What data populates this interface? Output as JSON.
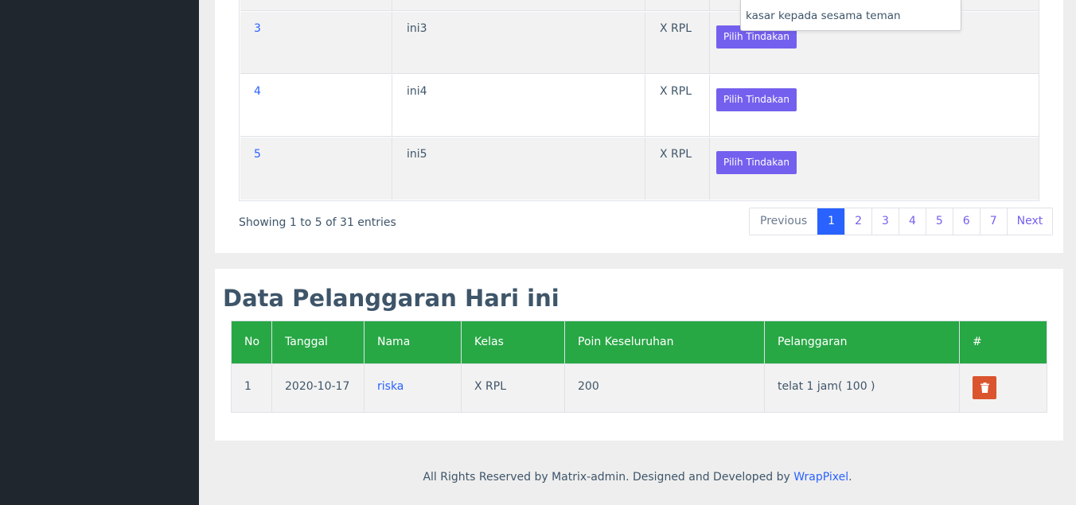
{
  "table_top": {
    "rows": [
      {
        "no": "3",
        "nama": "ini3",
        "kelas": "X RPL",
        "action": "Pilih Tindakan"
      },
      {
        "no": "4",
        "nama": "ini4",
        "kelas": "X RPL",
        "action": "Pilih Tindakan"
      },
      {
        "no": "5",
        "nama": "ini5",
        "kelas": "X RPL",
        "action": "Pilih Tindakan"
      }
    ],
    "dropdown_text": "kasar kepada sesama teman",
    "info": "Showing 1 to 5 of 31 entries",
    "pagination": {
      "previous": "Previous",
      "pages": [
        "1",
        "2",
        "3",
        "4",
        "5",
        "6",
        "7"
      ],
      "next": "Next",
      "active_page": "1"
    }
  },
  "pelanggaran": {
    "title": "Data Pelanggaran Hari ini",
    "headers": [
      "No",
      "Tanggal",
      "Nama",
      "Kelas",
      "Poin Keseluruhan",
      "Pelanggaran",
      "#"
    ],
    "rows": [
      {
        "no": "1",
        "tanggal": "2020-10-17",
        "nama": "riska",
        "kelas": "X RPL",
        "poin": "200",
        "pelanggaran": "telat 1 jam( 100 )"
      }
    ],
    "header_color": "#28a745",
    "delete_color": "#da542e"
  },
  "footer": {
    "text": "All Rights Reserved by Matrix-admin. Designed and Developed by ",
    "link": "WrapPixel",
    "end": "."
  },
  "colors": {
    "sidebar": "#1f262d",
    "accent_blue": "#2962ff",
    "button_purple": "#7460ee"
  }
}
